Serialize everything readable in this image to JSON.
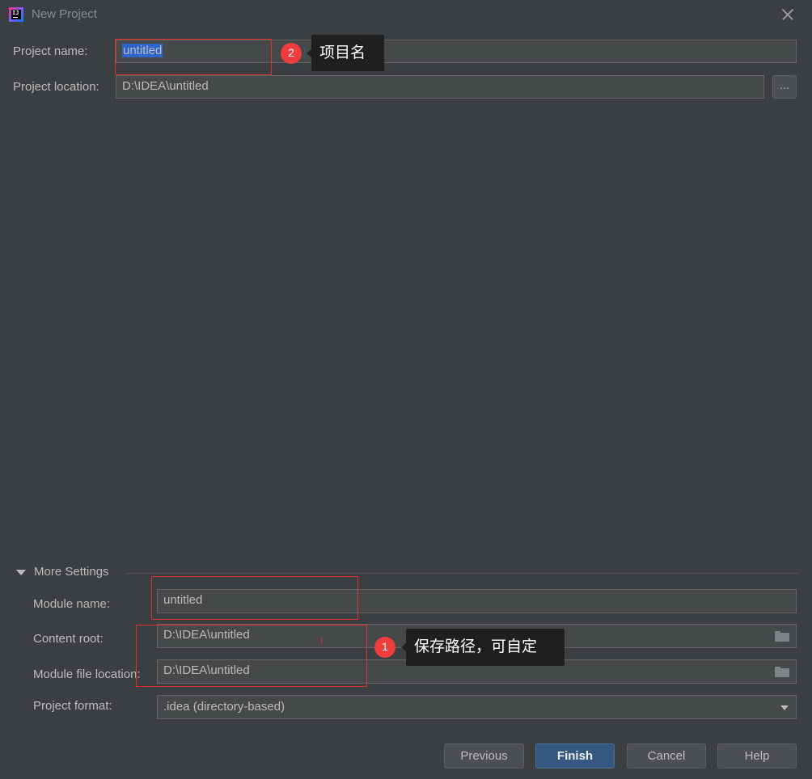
{
  "window": {
    "title": "New Project"
  },
  "form": {
    "project_name_label": "Project name:",
    "project_name_value": "untitled",
    "project_location_label": "Project location:",
    "project_location_value": "D:\\IDEA\\untitled",
    "browse_label": "..."
  },
  "more_settings": {
    "label": "More Settings",
    "expanded": true,
    "module_name_label": "Module name:",
    "module_name_value": "untitled",
    "content_root_label": "Content root:",
    "content_root_value": "D:\\IDEA\\untitled",
    "module_file_location_label": "Module file location:",
    "module_file_location_value": "D:\\IDEA\\untitled",
    "project_format_label": "Project format:",
    "project_format_value": ".idea (directory-based)"
  },
  "buttons": {
    "previous": "Previous",
    "finish": "Finish",
    "cancel": "Cancel",
    "help": "Help"
  },
  "annotations": {
    "callout_1": {
      "number": "1",
      "text": "保存路径，可自定"
    },
    "callout_2": {
      "number": "2",
      "text": "项目名"
    },
    "color": "#e0302a"
  },
  "icons": [
    "app-logo-icon",
    "close-icon",
    "folder-icon",
    "triangle-down-icon",
    "chevron-down-icon"
  ],
  "colors": {
    "background": "#3c3f41",
    "field": "#45494a",
    "primary_button": "#365880",
    "selection": "#2f65ca"
  }
}
